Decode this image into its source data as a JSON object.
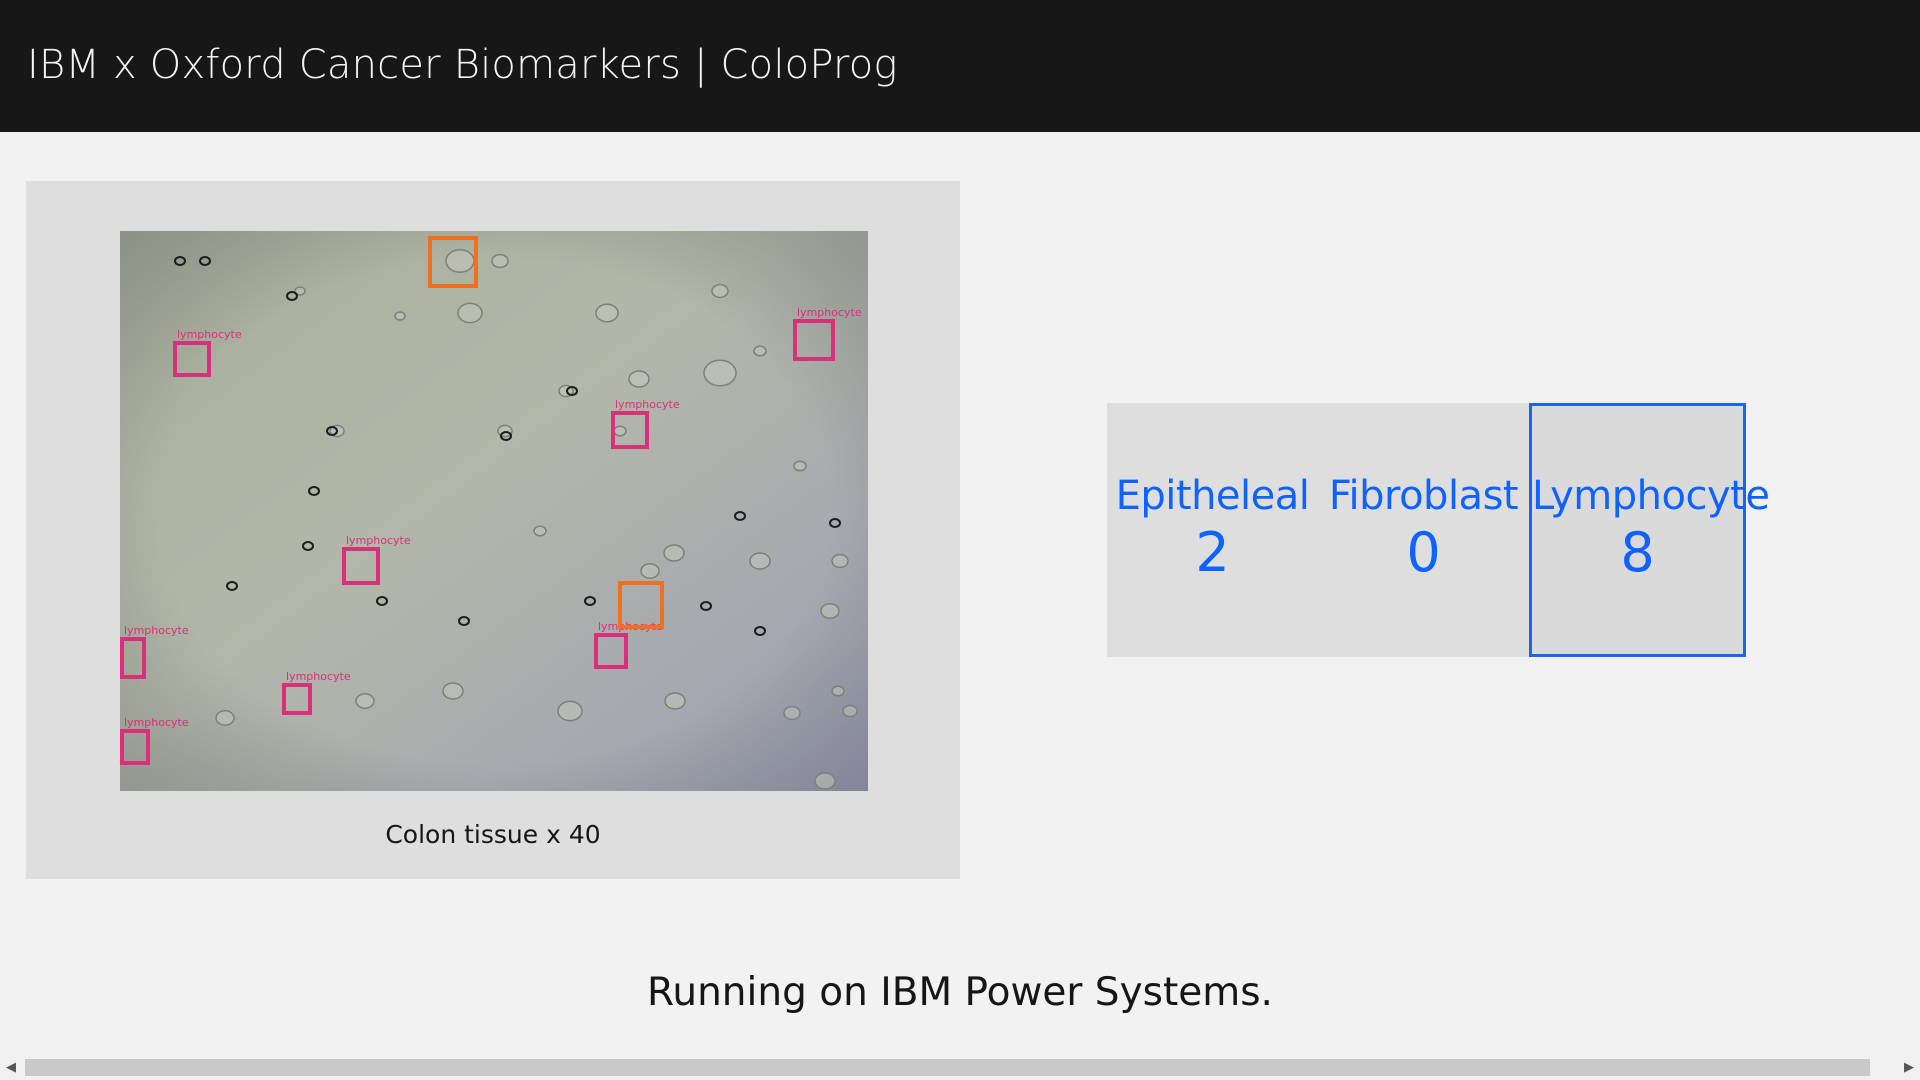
{
  "header": {
    "title": "IBM x Oxford Cancer Biomarkers | ColoProg"
  },
  "image_card": {
    "caption": "Colon tissue x 40",
    "detection_label": "lymphocyte",
    "box_colors": {
      "lymphocyte": "#d9307a",
      "other": "#f07020"
    }
  },
  "counts": [
    {
      "label": "Epitheleal",
      "value": "2"
    },
    {
      "label": "Fibroblast",
      "value": "0"
    },
    {
      "label": "Lymphocyte",
      "value": "8"
    }
  ],
  "footer": {
    "text": "Running on IBM Power Systems."
  },
  "scrollbar": {
    "left_arrow": "◀",
    "right_arrow": "▶"
  },
  "colors": {
    "header_bg": "#171717",
    "page_bg": "#f2f2f2",
    "card_bg": "#dedede",
    "accent": "#0f62fe"
  }
}
